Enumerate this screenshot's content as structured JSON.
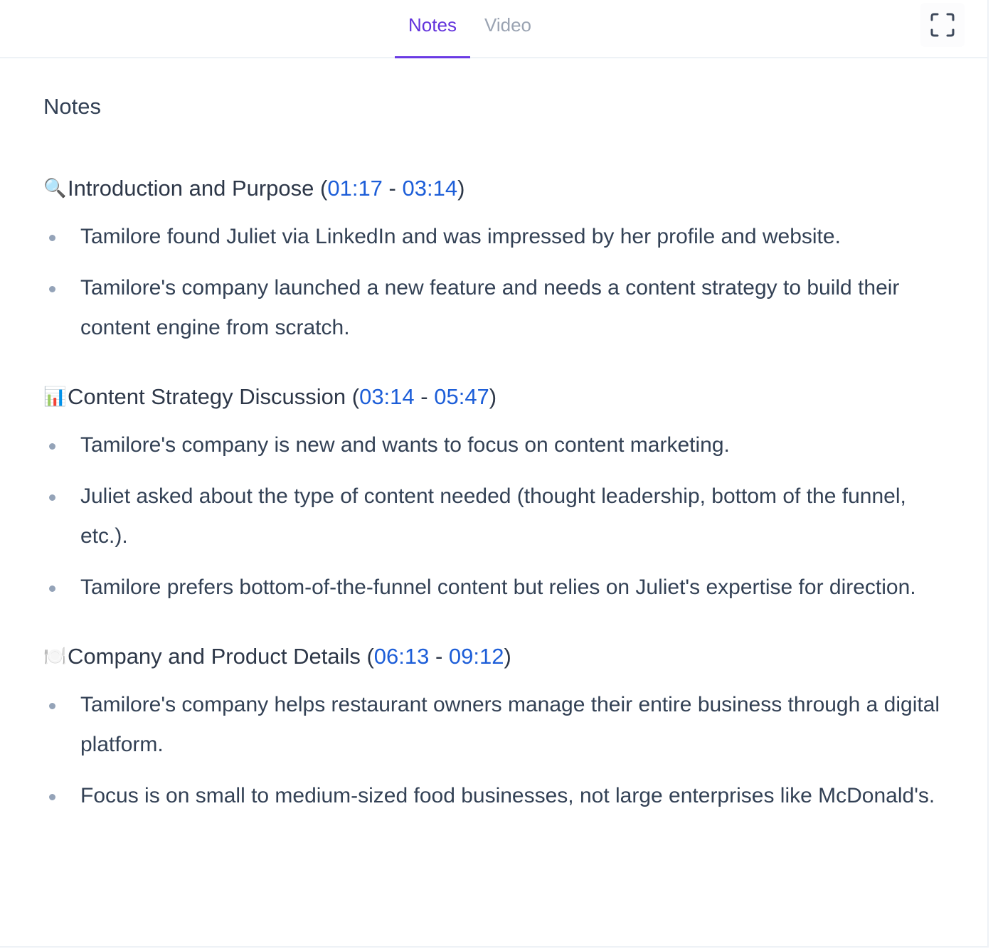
{
  "tabs": [
    {
      "label": "Notes",
      "active": true
    },
    {
      "label": "Video",
      "active": false
    }
  ],
  "toolbar": {
    "expand_icon": "expand-fullscreen-icon"
  },
  "colors": {
    "accent": "#6232dc",
    "tab_underline": "#6a3be4",
    "timestamp_link": "#1d5ed8",
    "text": "#334155",
    "bullet": "#94a3b8",
    "inactive_tab": "#9aa3b2"
  },
  "notes": {
    "title": "Notes",
    "sections": [
      {
        "emoji": "🔍",
        "icon": "magnifying-glass-icon",
        "title": "Introduction and Purpose",
        "open_paren": " (",
        "start": "01:17",
        "separator": " - ",
        "end": "03:14",
        "close_paren": ")",
        "bullets": [
          "Tamilore found Juliet via LinkedIn and was impressed by her profile and website.",
          "Tamilore's company launched a new feature and needs a content strategy to build their content engine from scratch."
        ]
      },
      {
        "emoji": "📊",
        "icon": "bar-chart-icon",
        "title": "Content Strategy Discussion",
        "open_paren": " (",
        "start": "03:14",
        "separator": " - ",
        "end": "05:47",
        "close_paren": ")",
        "bullets": [
          "Tamilore's company is new and wants to focus on content marketing.",
          "Juliet asked about the type of content needed (thought leadership, bottom of the funnel, etc.).",
          "Tamilore prefers bottom-of-the-funnel content but relies on Juliet's expertise for direction."
        ]
      },
      {
        "emoji": "🍽️",
        "icon": "plate-cutlery-icon",
        "title": "Company and Product Details",
        "open_paren": " (",
        "start": "06:13",
        "separator": " - ",
        "end": "09:12",
        "close_paren": ")",
        "bullets": [
          "Tamilore's company helps restaurant owners manage their entire business through a digital platform.",
          "Focus is on small to medium-sized food businesses, not large enterprises like McDonald's."
        ]
      }
    ]
  }
}
